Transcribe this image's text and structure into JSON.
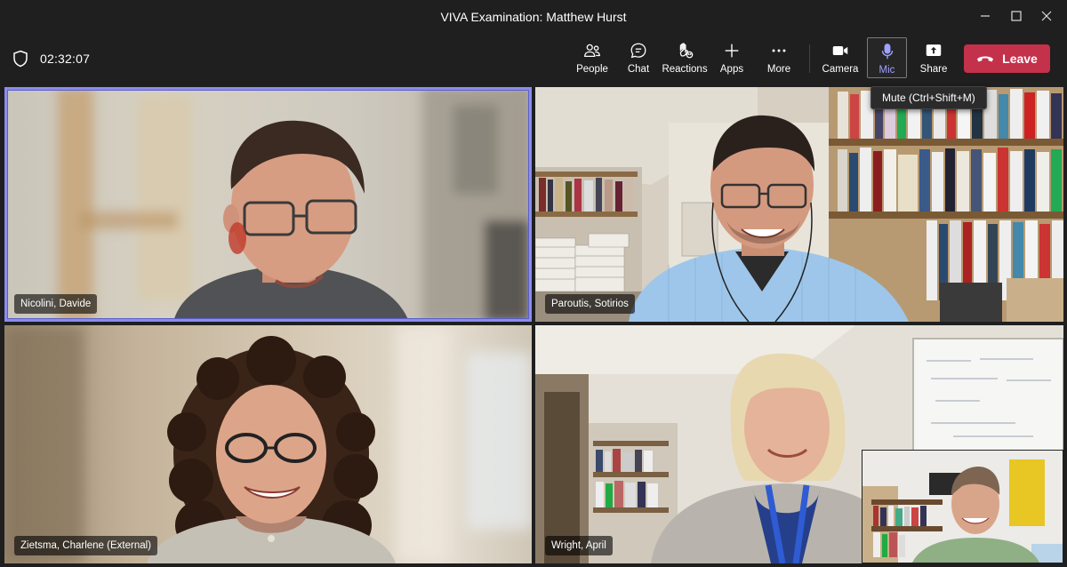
{
  "window": {
    "title": "VIVA Examination: Matthew Hurst"
  },
  "meeting": {
    "elapsed": "02:32:07"
  },
  "toolbar": {
    "people_label": "People",
    "chat_label": "Chat",
    "reactions_label": "Reactions",
    "apps_label": "Apps",
    "more_label": "More",
    "camera_label": "Camera",
    "mic_label": "Mic",
    "share_label": "Share",
    "leave_label": "Leave"
  },
  "tooltip": {
    "mic": "Mute (Ctrl+Shift+M)"
  },
  "participants": [
    {
      "name": "Nicolini, Davide",
      "speaking": true
    },
    {
      "name": "Paroutis, Sotirios",
      "speaking": false
    },
    {
      "name": "Zietsma, Charlene (External)",
      "speaking": false
    },
    {
      "name": "Wright, April",
      "speaking": false
    }
  ],
  "colors": {
    "active_speaker_ring": "#8b8cf0",
    "leave_button": "#c4314b",
    "mic_active": "#9ea2ff",
    "background": "#1f1f1f"
  }
}
